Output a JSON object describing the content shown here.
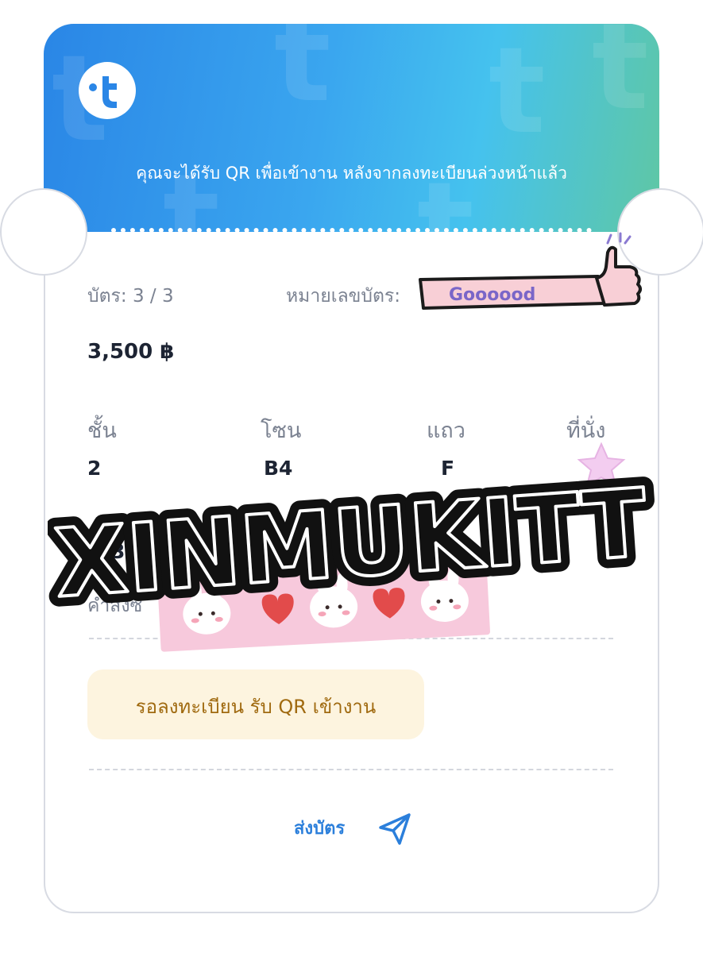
{
  "header": {
    "notice": "คุณจะได้รับ QR เพื่อเข้างาน หลังจากลงทะเบียนล่วงหน้าแล้ว",
    "logo_icon": "ticket-brand-logo-icon"
  },
  "ticket": {
    "count_label": "บัตร: 3 / 3",
    "number_label": "หมายเลขบัตร:",
    "price": "3,500 ฿",
    "floor_label": "ชั้น",
    "zone_label": "โซน",
    "row_label": "แถว",
    "seat_label": "ที่นั่ง",
    "floor_value": "2",
    "zone_value": "B4",
    "row_value": "F",
    "partial_value": "3,",
    "partial_label": "คำสั่งซื"
  },
  "status": {
    "badge_text": "รอลงทะเบียน รับ QR เข้างาน"
  },
  "actions": {
    "send_label": "ส่งบัตร",
    "send_icon": "paper-plane-icon"
  },
  "stickers": {
    "thumb_text": "Goooood",
    "stamp_text": "XINMUKITT"
  },
  "colors": {
    "header_start": "#2a86e6",
    "header_end": "#5fc7a4",
    "accent_blue": "#2b7fdb",
    "badge_bg": "#fdf4df",
    "badge_text": "#a06a10"
  }
}
